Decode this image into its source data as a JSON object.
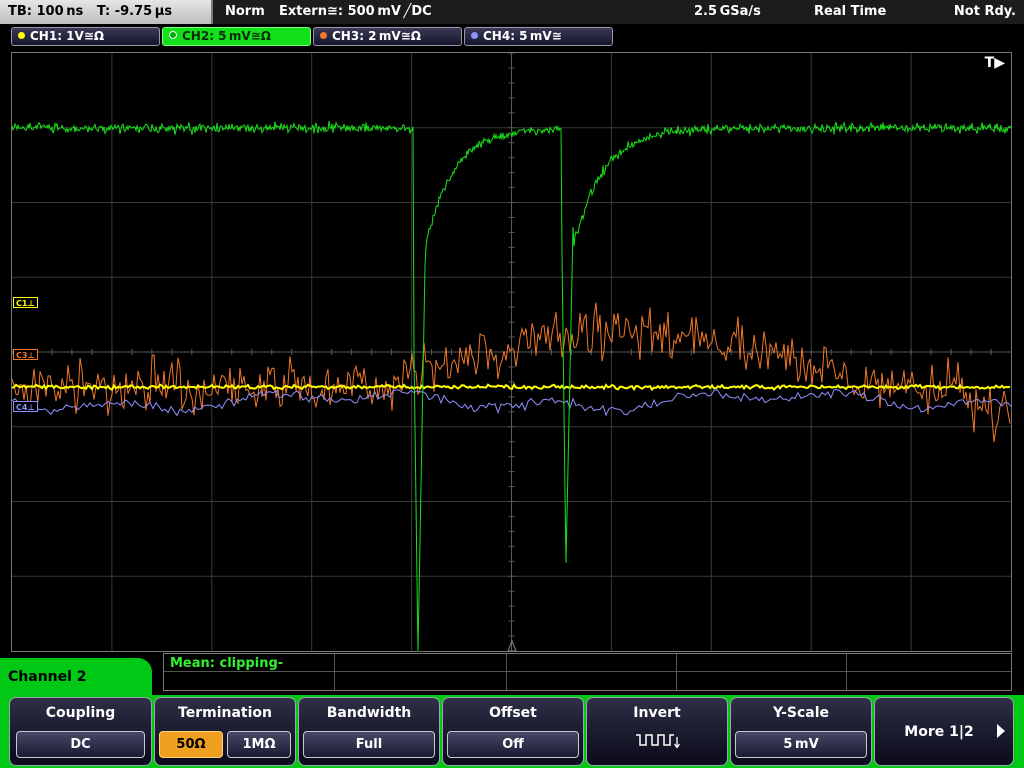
{
  "status": {
    "timebase": "TB: 100 ns",
    "trigger_time": "T: -9.75 µs",
    "mode": "Norm",
    "trigger_source": "Extern≅: 500 mV ╱DC",
    "sample_rate": "2.5 GSa/s",
    "acq_mode": "Real Time",
    "state": "Not Rdy."
  },
  "channels": [
    {
      "label": "CH1: 1V≅Ω",
      "color": "#ffff00",
      "active": false
    },
    {
      "label": "CH2: 5 mV≅Ω",
      "color": "#19e119",
      "active": true
    },
    {
      "label": "CH3: 2 mV≅Ω",
      "color": "#f07828",
      "active": false
    },
    {
      "label": "CH4: 5 mV≅",
      "color": "#9090ff",
      "active": false
    }
  ],
  "scope": {
    "trigger_indicator": "T▶",
    "markers": [
      {
        "label": "C1⊥",
        "color": "#ffff00"
      },
      {
        "label": "C3⊥",
        "color": "#f07828"
      },
      {
        "label": "C4⊥",
        "color": "#9090ff"
      }
    ]
  },
  "measurement": {
    "mean": "Mean: clipping-"
  },
  "menu": {
    "title": "Channel 2",
    "coupling": {
      "label": "Coupling",
      "value": "DC"
    },
    "termination": {
      "label": "Termination",
      "opt1": "50Ω",
      "opt2": "1MΩ"
    },
    "bandwidth": {
      "label": "Bandwidth",
      "value": "Full"
    },
    "offset": {
      "label": "Offset",
      "value": "Off"
    },
    "invert": {
      "label": "Invert",
      "icon": "invert-pulse-icon"
    },
    "yscale": {
      "label": "Y-Scale",
      "value": "5 mV"
    },
    "more": {
      "label": "More 1|2"
    }
  }
}
